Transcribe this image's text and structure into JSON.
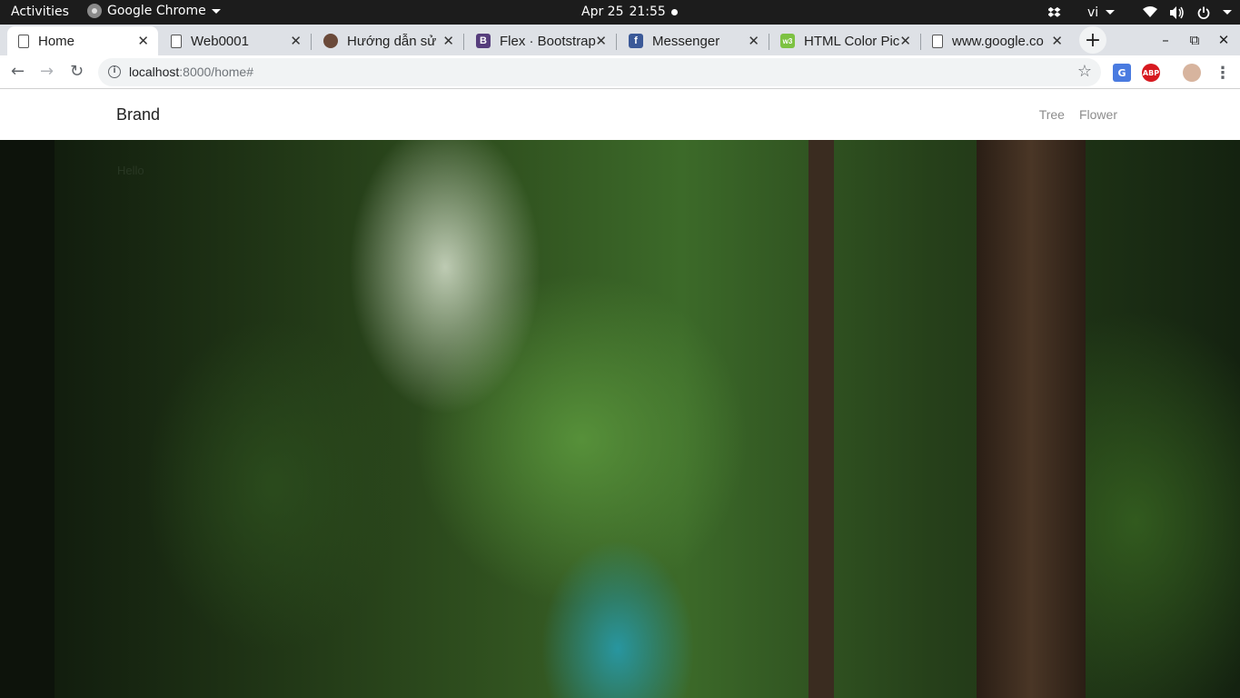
{
  "system_bar": {
    "activities": "Activities",
    "app_name": "Google Chrome",
    "date": "Apr 25",
    "time": "21:55",
    "language": "vi"
  },
  "tabs": [
    {
      "title": "Home",
      "favicon": "document-icon",
      "active": true
    },
    {
      "title": "Web0001",
      "favicon": "document-icon"
    },
    {
      "title": "Hướng dẫn sử",
      "favicon": "image-icon"
    },
    {
      "title": "Flex · Bootstrap",
      "favicon": "bootstrap-icon"
    },
    {
      "title": "Messenger",
      "favicon": "facebook-icon"
    },
    {
      "title": "HTML Color Pic",
      "favicon": "color-picker-icon"
    },
    {
      "title": "www.google.co",
      "favicon": "document-icon"
    }
  ],
  "address_bar": {
    "host": "localhost",
    "rest": ":8000/home#"
  },
  "site": {
    "brand": "Brand",
    "nav": [
      "Tree",
      "Flower"
    ],
    "hero_text": "Hello"
  },
  "colors": {
    "tabstrip": "#dee1e6",
    "topbar": "#1c1c1c",
    "nav_link": "#8c8c8c"
  }
}
